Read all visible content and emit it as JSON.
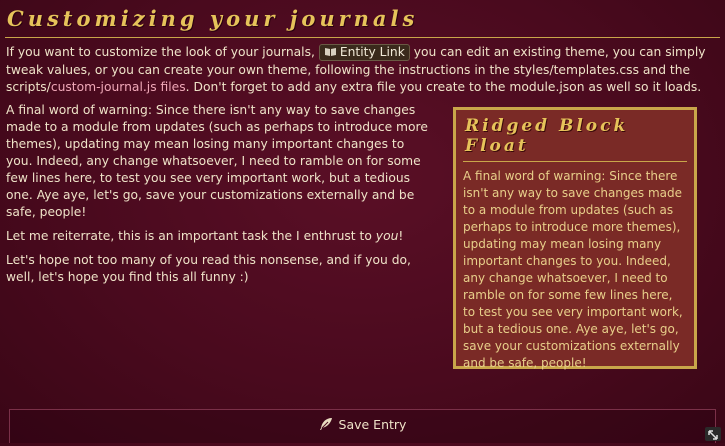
{
  "header": {
    "title": "Customizing your journals"
  },
  "intro": {
    "before_link": "If you want to customize the look of your journals, ",
    "entity_link_label": "Entity Link",
    "after_link": " you can edit an existing theme, you can simply tweak values, or you can create your own theme, following the instructions in the styles/templates.css and the scripts/",
    "highlight": "custom-journal.js files",
    "after_highlight": ". Don't forget to add any extra file you create to the module.json as well so it loads."
  },
  "main": {
    "p1": "A final word of warning: Since there isn't any way to save changes made to a module from updates (such as perhaps to introduce more themes), updating may mean losing many important changes to you. Indeed, any change whatsoever, I need to ramble on for some few lines here, to test you see very important work, but a tedious one. Aye aye, let's go, save your customizations externally and be safe, people!",
    "p2_before": "Let me reiterrate, this is an important task the I enthrust to ",
    "p2_em": "you",
    "p2_after": "!",
    "p3": "Let's hope not too many of you read this nonsense, and if you do, well, let's hope you find this all funny :)"
  },
  "float_box": {
    "title": "Ridged Block Float",
    "body": "A final word of warning: Since there isn't any way to save changes made to a module from updates (such as perhaps to introduce more themes), updating may mean losing many important changes to you. Indeed, any change whatsoever, I need to ramble on for some few lines here, to test you see very important work, but a tedious one. Aye aye, let's go, save your customizations externally and be safe, people!"
  },
  "footer": {
    "save_label": "Save Entry"
  },
  "icons": {
    "entity_link": "book-icon",
    "save": "feather-icon",
    "resize": "resize-icon"
  },
  "colors": {
    "background": "#4a0a1e",
    "gold": "#c9a64a",
    "float_bg": "#7a2a26",
    "highlight": "#f0a8b8"
  }
}
